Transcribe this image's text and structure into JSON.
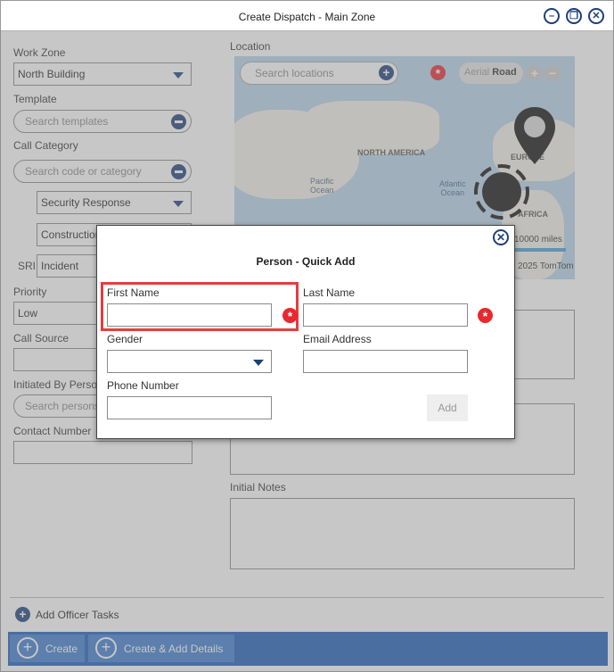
{
  "window": {
    "title": "Create Dispatch - Main Zone"
  },
  "form": {
    "work_zone_label": "Work Zone",
    "work_zone_value": "North Building",
    "template_label": "Template",
    "template_placeholder": "Search templates",
    "call_category_label": "Call Category",
    "call_category_placeholder": "Search code or category",
    "category_select_1": "Security Response",
    "category_select_2": "Construction",
    "sri_label": "SRI",
    "sri_value": "Incident",
    "priority_label": "Priority",
    "priority_value": "Low",
    "call_source_label": "Call Source",
    "initiated_by_label": "Initiated By Person",
    "initiated_by_placeholder": "Search persons",
    "contact_number_label": "Contact Number",
    "location_label": "Location",
    "initial_notes_label": "Initial Notes",
    "add_officer_tasks": "Add Officer Tasks"
  },
  "map": {
    "search_placeholder": "Search locations",
    "type_aerial": "Aerial",
    "type_road": "Road",
    "labels": {
      "north_america": "NORTH AMERICA",
      "europe": "EUROPE",
      "africa": "AFRICA",
      "pacific": "Pacific\nOcean",
      "atlantic": "Atlantic\nOcean"
    },
    "scale": "10000 miles",
    "copyright": "2025 TomTom"
  },
  "footer": {
    "create": "Create",
    "create_add_details": "Create & Add Details"
  },
  "modal": {
    "title": "Person - Quick Add",
    "first_name_label": "First Name",
    "first_name_value": "",
    "last_name_label": "Last Name",
    "last_name_value": "",
    "gender_label": "Gender",
    "gender_value": "",
    "email_label": "Email Address",
    "email_value": "",
    "phone_label": "Phone Number",
    "phone_value": "",
    "add_button": "Add"
  },
  "colors": {
    "accent": "#1d3f7a",
    "required": "#e8282f",
    "footer": "#1d5db8",
    "highlight": "#e53d3d"
  }
}
